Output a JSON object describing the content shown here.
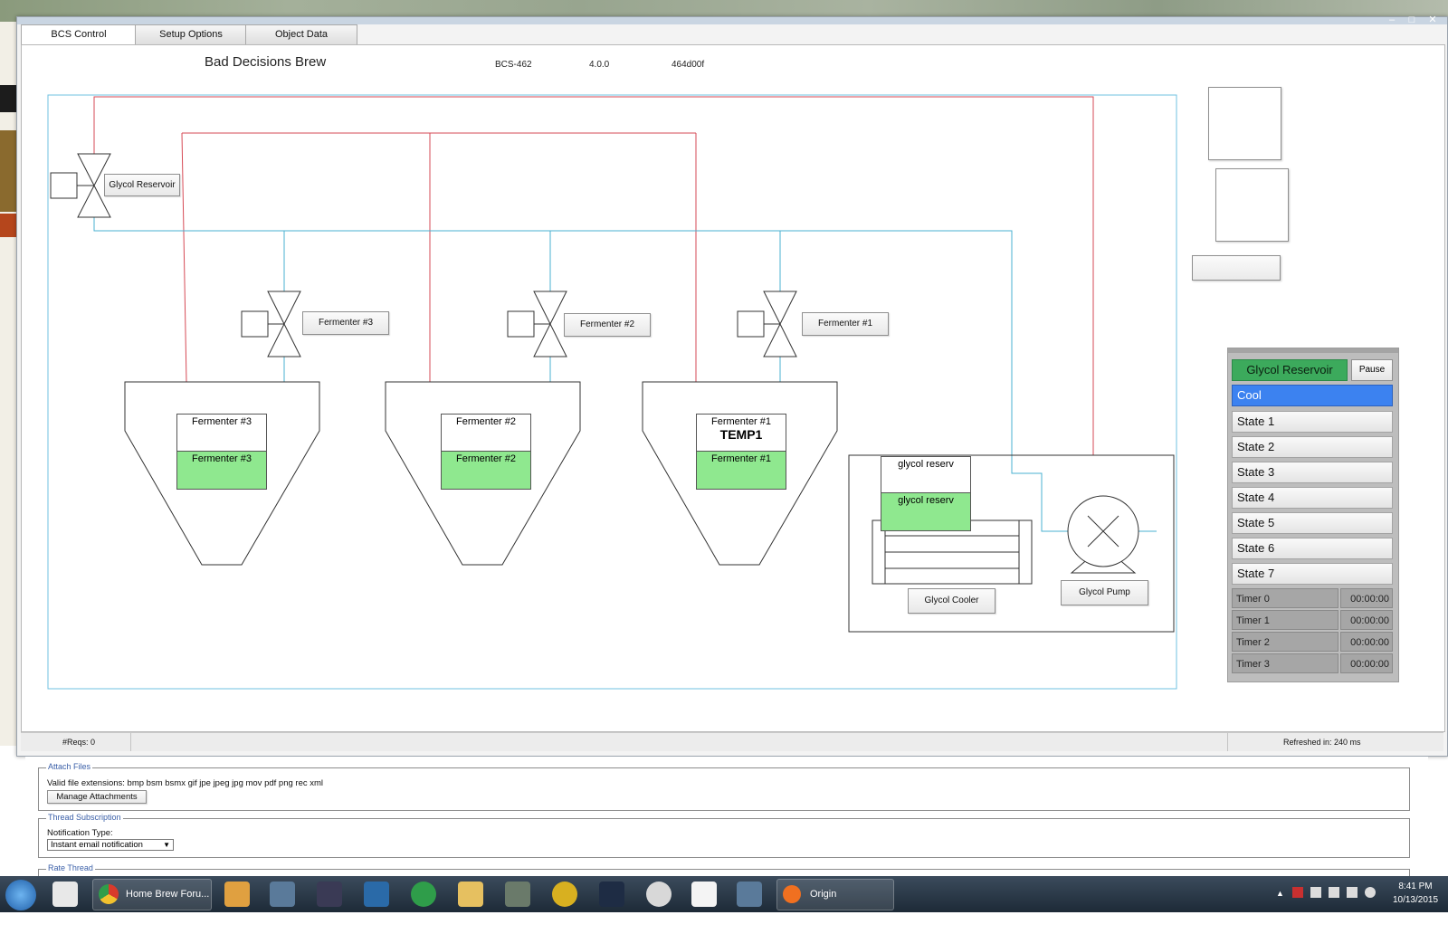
{
  "window": {
    "tabs": [
      "BCS Control",
      "Setup Options",
      "Object Data"
    ],
    "header": {
      "title": "Bad Decisions Brew",
      "device": "BCS-462",
      "version": "4.0.0",
      "id": "464d00f"
    }
  },
  "diagram": {
    "glycol_valve_label": "Glycol Reservoir",
    "valves": [
      "Fermenter #3",
      "Fermenter #2",
      "Fermenter #1"
    ],
    "tanks": [
      {
        "name": "Fermenter #3",
        "temp": "",
        "output": "Fermenter #3"
      },
      {
        "name": "Fermenter #2",
        "temp": "",
        "output": "Fermenter #2"
      },
      {
        "name": "Fermenter #1",
        "temp": "TEMP1",
        "output": "Fermenter #1"
      }
    ],
    "cooler": {
      "sensor": "glycol reserv",
      "output": "glycol reserv",
      "cooler_label": "Glycol Cooler",
      "pump_label": "Glycol Pump"
    }
  },
  "panel": {
    "process": "Glycol Reservoir",
    "pause": "Pause",
    "states": [
      "Cool",
      "State 1",
      "State 2",
      "State 3",
      "State 4",
      "State 5",
      "State 6",
      "State 7"
    ],
    "timers": [
      {
        "name": "Timer 0",
        "value": "00:00:00"
      },
      {
        "name": "Timer 1",
        "value": "00:00:00"
      },
      {
        "name": "Timer 2",
        "value": "00:00:00"
      },
      {
        "name": "Timer 3",
        "value": "00:00:00"
      }
    ]
  },
  "status": {
    "reqs": "#Reqs: 0",
    "refreshed": "Refreshed in: 240 ms"
  },
  "forum": {
    "attach_legend": "Attach Files",
    "valid_ext": "Valid file extensions: bmp bsm bsmx gif jpe jpeg jpg mov pdf png rec xml",
    "manage_btn": "Manage Attachments",
    "sub_legend": "Thread Subscription",
    "notif_label": "Notification Type:",
    "notif_value": "Instant email notification",
    "rate_legend": "Rate Thread"
  },
  "taskbar": {
    "items": [
      "Home Brew Foru...",
      "Origin"
    ],
    "clock_time": "8:41 PM",
    "clock_date": "10/13/2015"
  },
  "colors": {
    "active_state": "#3c82f0",
    "process_green": "#3caa5c",
    "output_green": "#8fe88f",
    "hot_pipe": "#d64a55",
    "cold_pipe": "#4ab0d0"
  }
}
